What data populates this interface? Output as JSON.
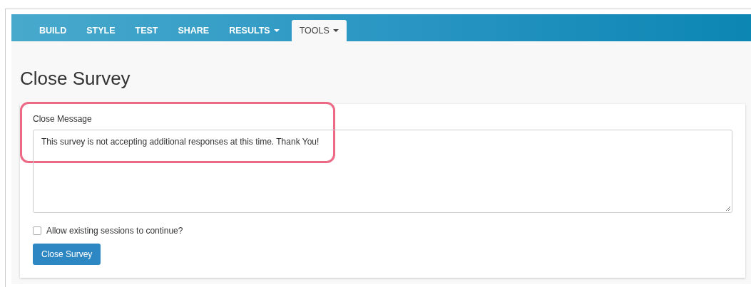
{
  "tabs": [
    {
      "label": "BUILD",
      "selected": false,
      "dropdown": false
    },
    {
      "label": "STYLE",
      "selected": false,
      "dropdown": false
    },
    {
      "label": "TEST",
      "selected": false,
      "dropdown": false
    },
    {
      "label": "SHARE",
      "selected": false,
      "dropdown": false
    },
    {
      "label": "RESULTS",
      "selected": false,
      "dropdown": true
    },
    {
      "label": "TOOLS",
      "selected": true,
      "dropdown": true
    }
  ],
  "page_title": "Close Survey",
  "form": {
    "label": "Close Message",
    "value": "This survey is not accepting additional responses at this time. Thank You!",
    "highlighted": true,
    "checkbox": {
      "label": "Allow existing sessions to continue?",
      "checked": false
    },
    "button": "Close Survey"
  }
}
